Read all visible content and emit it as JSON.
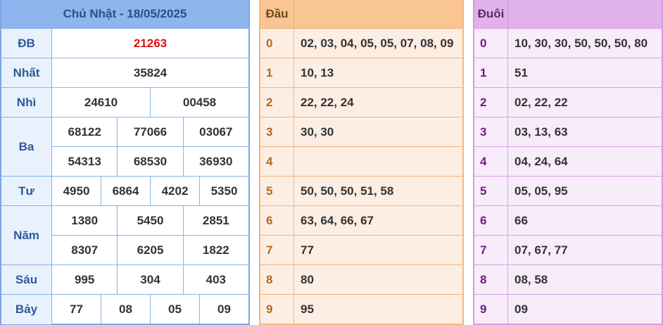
{
  "results": {
    "title": "Chủ Nhật - 18/05/2025",
    "prizes": [
      {
        "name": "ĐB",
        "rows": [
          [
            "21263"
          ]
        ]
      },
      {
        "name": "Nhất",
        "rows": [
          [
            "35824"
          ]
        ]
      },
      {
        "name": "Nhì",
        "rows": [
          [
            "24610",
            "00458"
          ]
        ]
      },
      {
        "name": "Ba",
        "rows": [
          [
            "68122",
            "77066",
            "03067"
          ],
          [
            "54313",
            "68530",
            "36930"
          ]
        ]
      },
      {
        "name": "Tư",
        "rows": [
          [
            "4950",
            "6864",
            "4202",
            "5350"
          ]
        ]
      },
      {
        "name": "Năm",
        "rows": [
          [
            "1380",
            "5450",
            "2851"
          ],
          [
            "8307",
            "6205",
            "1822"
          ]
        ]
      },
      {
        "name": "Sáu",
        "rows": [
          [
            "995",
            "304",
            "403"
          ]
        ]
      },
      {
        "name": "Bảy",
        "rows": [
          [
            "77",
            "08",
            "05",
            "09"
          ]
        ]
      }
    ]
  },
  "dau": {
    "header": "Đầu",
    "rows": [
      {
        "key": "0",
        "values": "02, 03, 04, 05, 05, 07, 08, 09"
      },
      {
        "key": "1",
        "values": "10, 13"
      },
      {
        "key": "2",
        "values": "22, 22, 24"
      },
      {
        "key": "3",
        "values": "30, 30"
      },
      {
        "key": "4",
        "values": ""
      },
      {
        "key": "5",
        "values": "50, 50, 50, 51, 58"
      },
      {
        "key": "6",
        "values": "63, 64, 66, 67"
      },
      {
        "key": "7",
        "values": "77"
      },
      {
        "key": "8",
        "values": "80"
      },
      {
        "key": "9",
        "values": "95"
      }
    ]
  },
  "duoi": {
    "header": "Đuôi",
    "rows": [
      {
        "key": "0",
        "values": "10, 30, 30, 50, 50, 50, 80"
      },
      {
        "key": "1",
        "values": "51"
      },
      {
        "key": "2",
        "values": "02, 22, 22"
      },
      {
        "key": "3",
        "values": "03, 13, 63"
      },
      {
        "key": "4",
        "values": "04, 24, 64"
      },
      {
        "key": "5",
        "values": "05, 05, 95"
      },
      {
        "key": "6",
        "values": "66"
      },
      {
        "key": "7",
        "values": "07, 67, 77"
      },
      {
        "key": "8",
        "values": "08, 58"
      },
      {
        "key": "9",
        "values": "09"
      }
    ]
  },
  "colors": {
    "special_number": "#e01010",
    "results_header": "#8fb5ef",
    "dau_header": "#f9c693",
    "duoi_header": "#e1b1ea"
  }
}
